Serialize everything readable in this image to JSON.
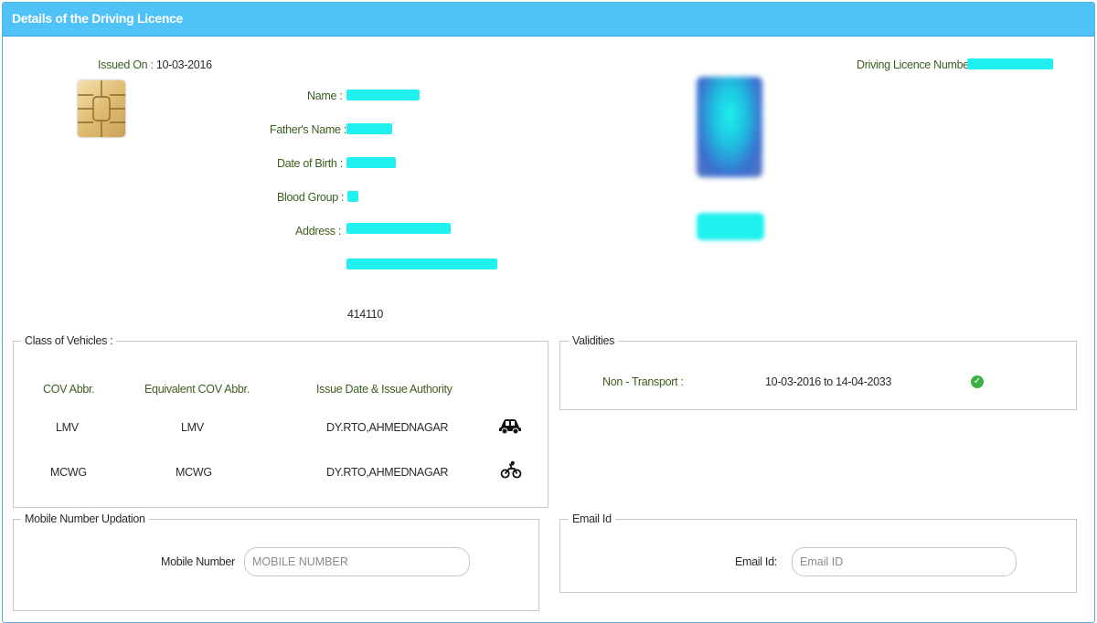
{
  "header": {
    "title": "Details of the Driving Licence"
  },
  "licence": {
    "issued_on_label": "Issued On :",
    "issued_on_value": "10-03-2016",
    "number_label": "Driving Licence Number :",
    "name_label": "Name :",
    "father_label": "Father's Name :",
    "dob_label": "Date of Birth :",
    "blood_label": "Blood Group :",
    "address_label": "Address :",
    "pincode": "414110"
  },
  "class_of_vehicles": {
    "legend": "Class of Vehicles :",
    "columns": [
      "COV Abbr.",
      "Equivalent COV Abbr.",
      "Issue Date & Issue Authority"
    ],
    "rows": [
      {
        "cov": "LMV",
        "equiv": "LMV",
        "authority": "DY.RTO,AHMEDNAGAR",
        "icon": "car-icon"
      },
      {
        "cov": "MCWG",
        "equiv": "MCWG",
        "authority": "DY.RTO,AHMEDNAGAR",
        "icon": "motorcycle-icon"
      }
    ]
  },
  "validities": {
    "legend": "Validities",
    "label": "Non - Transport :",
    "value": "10-03-2016 to 14-04-2033",
    "status_icon": "check-circle-icon"
  },
  "mobile": {
    "legend": "Mobile Number Updation",
    "label": "Mobile Number",
    "placeholder": "MOBILE NUMBER"
  },
  "email": {
    "legend": "Email Id",
    "label": "Email Id:",
    "placeholder": "Email ID"
  },
  "colors": {
    "header_bg": "#4fc3f7",
    "label_green": "#3b5d1f",
    "redaction": "#20f0ee",
    "status_green": "#3cb043"
  }
}
